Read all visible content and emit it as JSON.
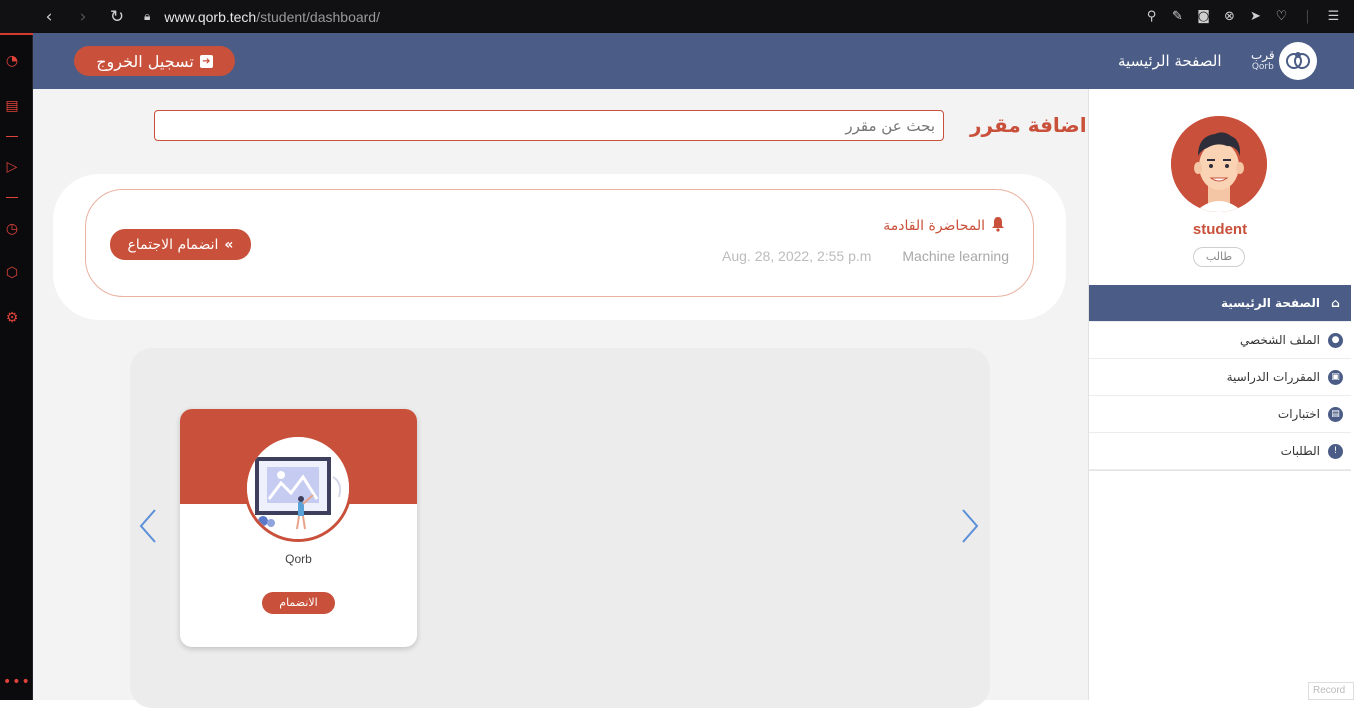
{
  "browser": {
    "url_domain": "www.qorb.tech",
    "url_path": "/student/dashboard/"
  },
  "header": {
    "logout_label": "تسجيل الخروج",
    "home_label": "الصفحة الرئيسية",
    "brand_ar": "قرب",
    "brand_en": "Qorb",
    "bg_color": "#4b5d86",
    "accent_color": "#c9503a"
  },
  "profile": {
    "name": "student",
    "role": "طالب"
  },
  "menu": {
    "items": [
      {
        "label": "الصفحة الرئيسية",
        "icon": "home-icon",
        "active": true
      },
      {
        "label": "الملف الشخصي",
        "icon": "user-icon",
        "active": false
      },
      {
        "label": "المقررات الدراسية",
        "icon": "book-icon",
        "active": false
      },
      {
        "label": "اختبارات",
        "icon": "quiz-icon",
        "active": false
      },
      {
        "label": "الطلبات",
        "icon": "alert-icon",
        "active": false
      }
    ]
  },
  "main": {
    "add_course_title": "اضافة مقرر",
    "search_placeholder": "بحث عن مقرر"
  },
  "lecture": {
    "title": "المحاضرة القادمة",
    "course": "Machine learning",
    "date": "Aug. 28, 2022, 2:55 p.m",
    "join_label": "انضمام الاجتماع"
  },
  "courses": [
    {
      "name": "Qorb",
      "join_label": "الانضمام"
    }
  ],
  "misc": {
    "record_label": "Record"
  }
}
